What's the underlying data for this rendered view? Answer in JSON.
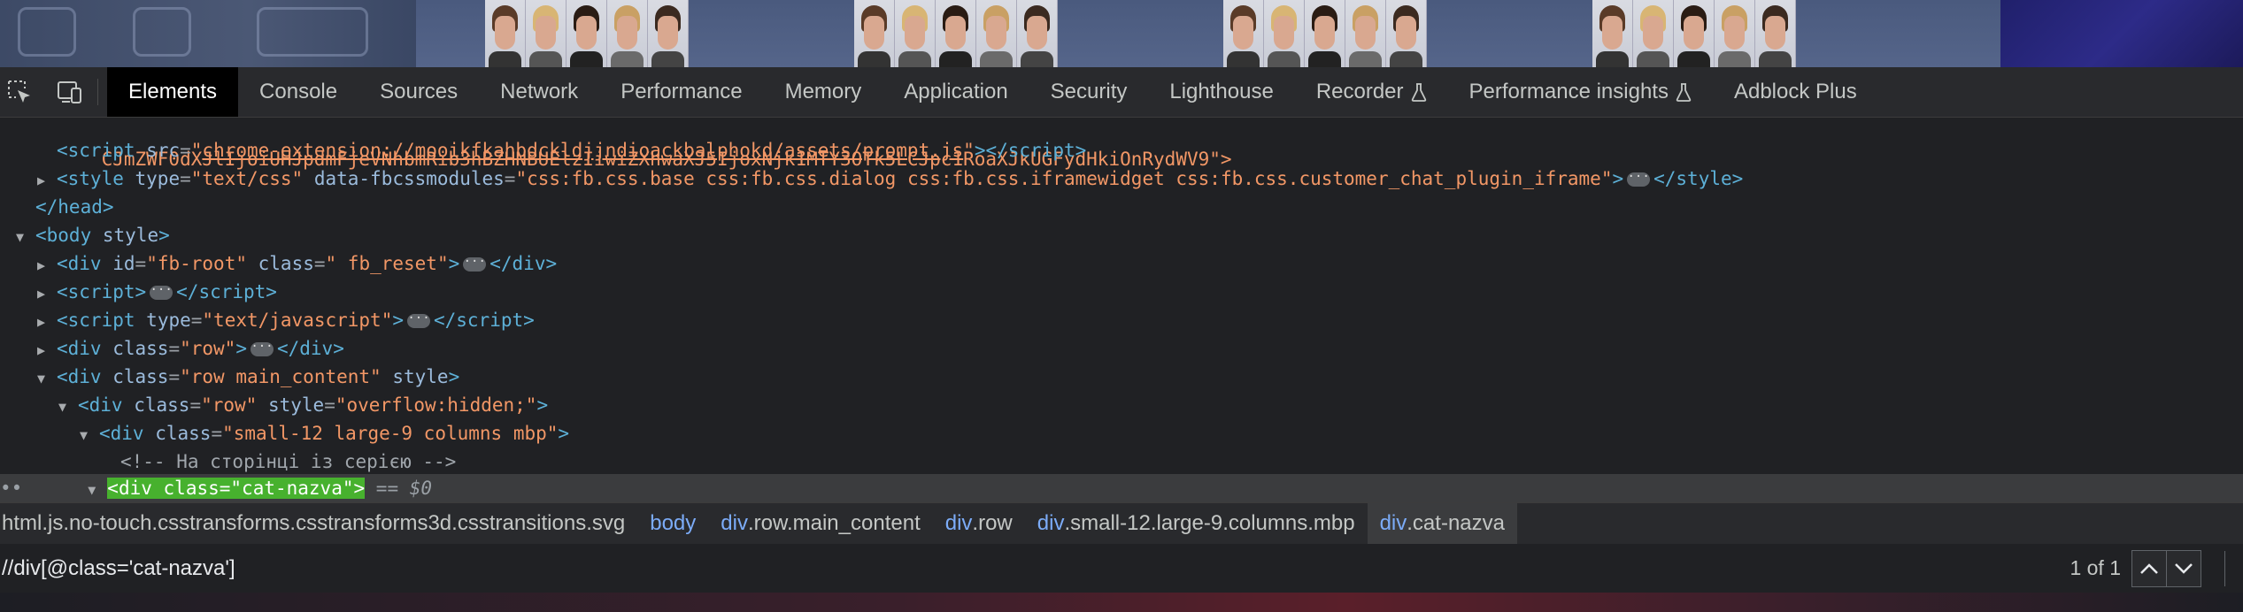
{
  "toolbar": {
    "tabs": [
      {
        "label": "Elements",
        "active": true
      },
      {
        "label": "Console"
      },
      {
        "label": "Sources"
      },
      {
        "label": "Network"
      },
      {
        "label": "Performance"
      },
      {
        "label": "Memory"
      },
      {
        "label": "Application"
      },
      {
        "label": "Security"
      },
      {
        "label": "Lighthouse"
      },
      {
        "label": "Recorder",
        "icon": "flask-icon"
      },
      {
        "label": "Performance insights",
        "icon": "flask-icon"
      },
      {
        "label": "Adblock Plus"
      }
    ]
  },
  "tree": {
    "line0": "CJmZWF0dXJlIjoiUHJpdmFjeVNhbmRib3hBZHNBUElzIiwiZXhwaXJ5IjoxNjk1MTY3OTk5LCJpc1RoaXJkUGFydHkiOnRydWV9\">",
    "script_src": "chrome-extension://mooikfkahbdckldjjndioackbalphokd/assets/prompt.js",
    "style_type": "\"text/css\"",
    "style_modules": "\"css:fb.css.base css:fb.css.dialog css:fb.css.iframewidget css:fb.css.customer_chat_plugin_iframe\"",
    "fbroot_id": "\"fb-root\"",
    "fbroot_class": "\" fb_reset\"",
    "js_type": "\"text/javascript\"",
    "row_class": "\"row\"",
    "main_class": "\"row main_content\"",
    "overflow_style": "\"overflow:hidden;\"",
    "columns_class": "\"small-12 large-9 columns mbp\"",
    "comment": "<!-- На сторінці із серією -->",
    "selected_class": "\"cat-nazva\"",
    "selected_suffix": "== $0"
  },
  "breadcrumbs": [
    {
      "tag": "html",
      "rest": ".js.no-touch.csstransforms.csstransforms3d.csstransitions.svg"
    },
    {
      "tag": "body",
      "rest": ""
    },
    {
      "tag": "div",
      "rest": ".row.main_content"
    },
    {
      "tag": "div",
      "rest": ".row"
    },
    {
      "tag": "div",
      "rest": ".small-12.large-9.columns.mbp"
    },
    {
      "tag": "div",
      "rest": ".cat-nazva"
    }
  ],
  "search": {
    "value": "//div[@class='cat-nazva']",
    "match_count": "1 of 1"
  },
  "colors": {
    "selected_node_highlight": "#47b12e",
    "tag": "#5db0d7",
    "attr_value": "#f29766"
  }
}
